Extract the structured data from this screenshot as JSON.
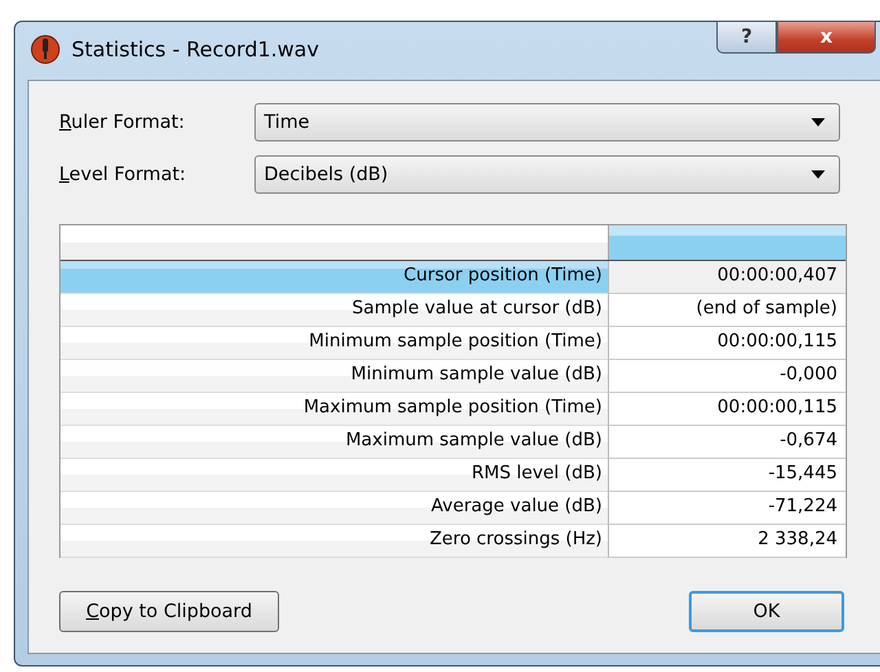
{
  "window": {
    "title": "Statistics - Record1.wav",
    "help_button": "?",
    "close_button": "x"
  },
  "fields": [
    {
      "label": "Ruler Format:",
      "value": "Time"
    },
    {
      "label": "Level Format:",
      "value": "Decibels (dB)"
    }
  ],
  "table": {
    "rows": [
      {
        "label": "Cursor position (Time)",
        "value": "00:00:00,407",
        "selected": true
      },
      {
        "label": "Sample value at cursor (dB)",
        "value": "(end of sample)",
        "selected": false
      },
      {
        "label": "Minimum sample position (Time)",
        "value": "00:00:00,115",
        "selected": false
      },
      {
        "label": "Minimum sample value (dB)",
        "value": "-0,000",
        "selected": false
      },
      {
        "label": "Maximum sample position (Time)",
        "value": "00:00:00,115",
        "selected": false
      },
      {
        "label": "Maximum sample value (dB)",
        "value": "-0,674",
        "selected": false
      },
      {
        "label": "RMS level (dB)",
        "value": "-15,445",
        "selected": false
      },
      {
        "label": "Average value (dB)",
        "value": "-71,224",
        "selected": false
      },
      {
        "label": "Zero crossings (Hz)",
        "value": "2 338,24",
        "selected": false
      }
    ]
  },
  "buttons": [
    {
      "label": "Copy to Clipboard",
      "default": false
    },
    {
      "label": "OK",
      "default": true
    }
  ]
}
